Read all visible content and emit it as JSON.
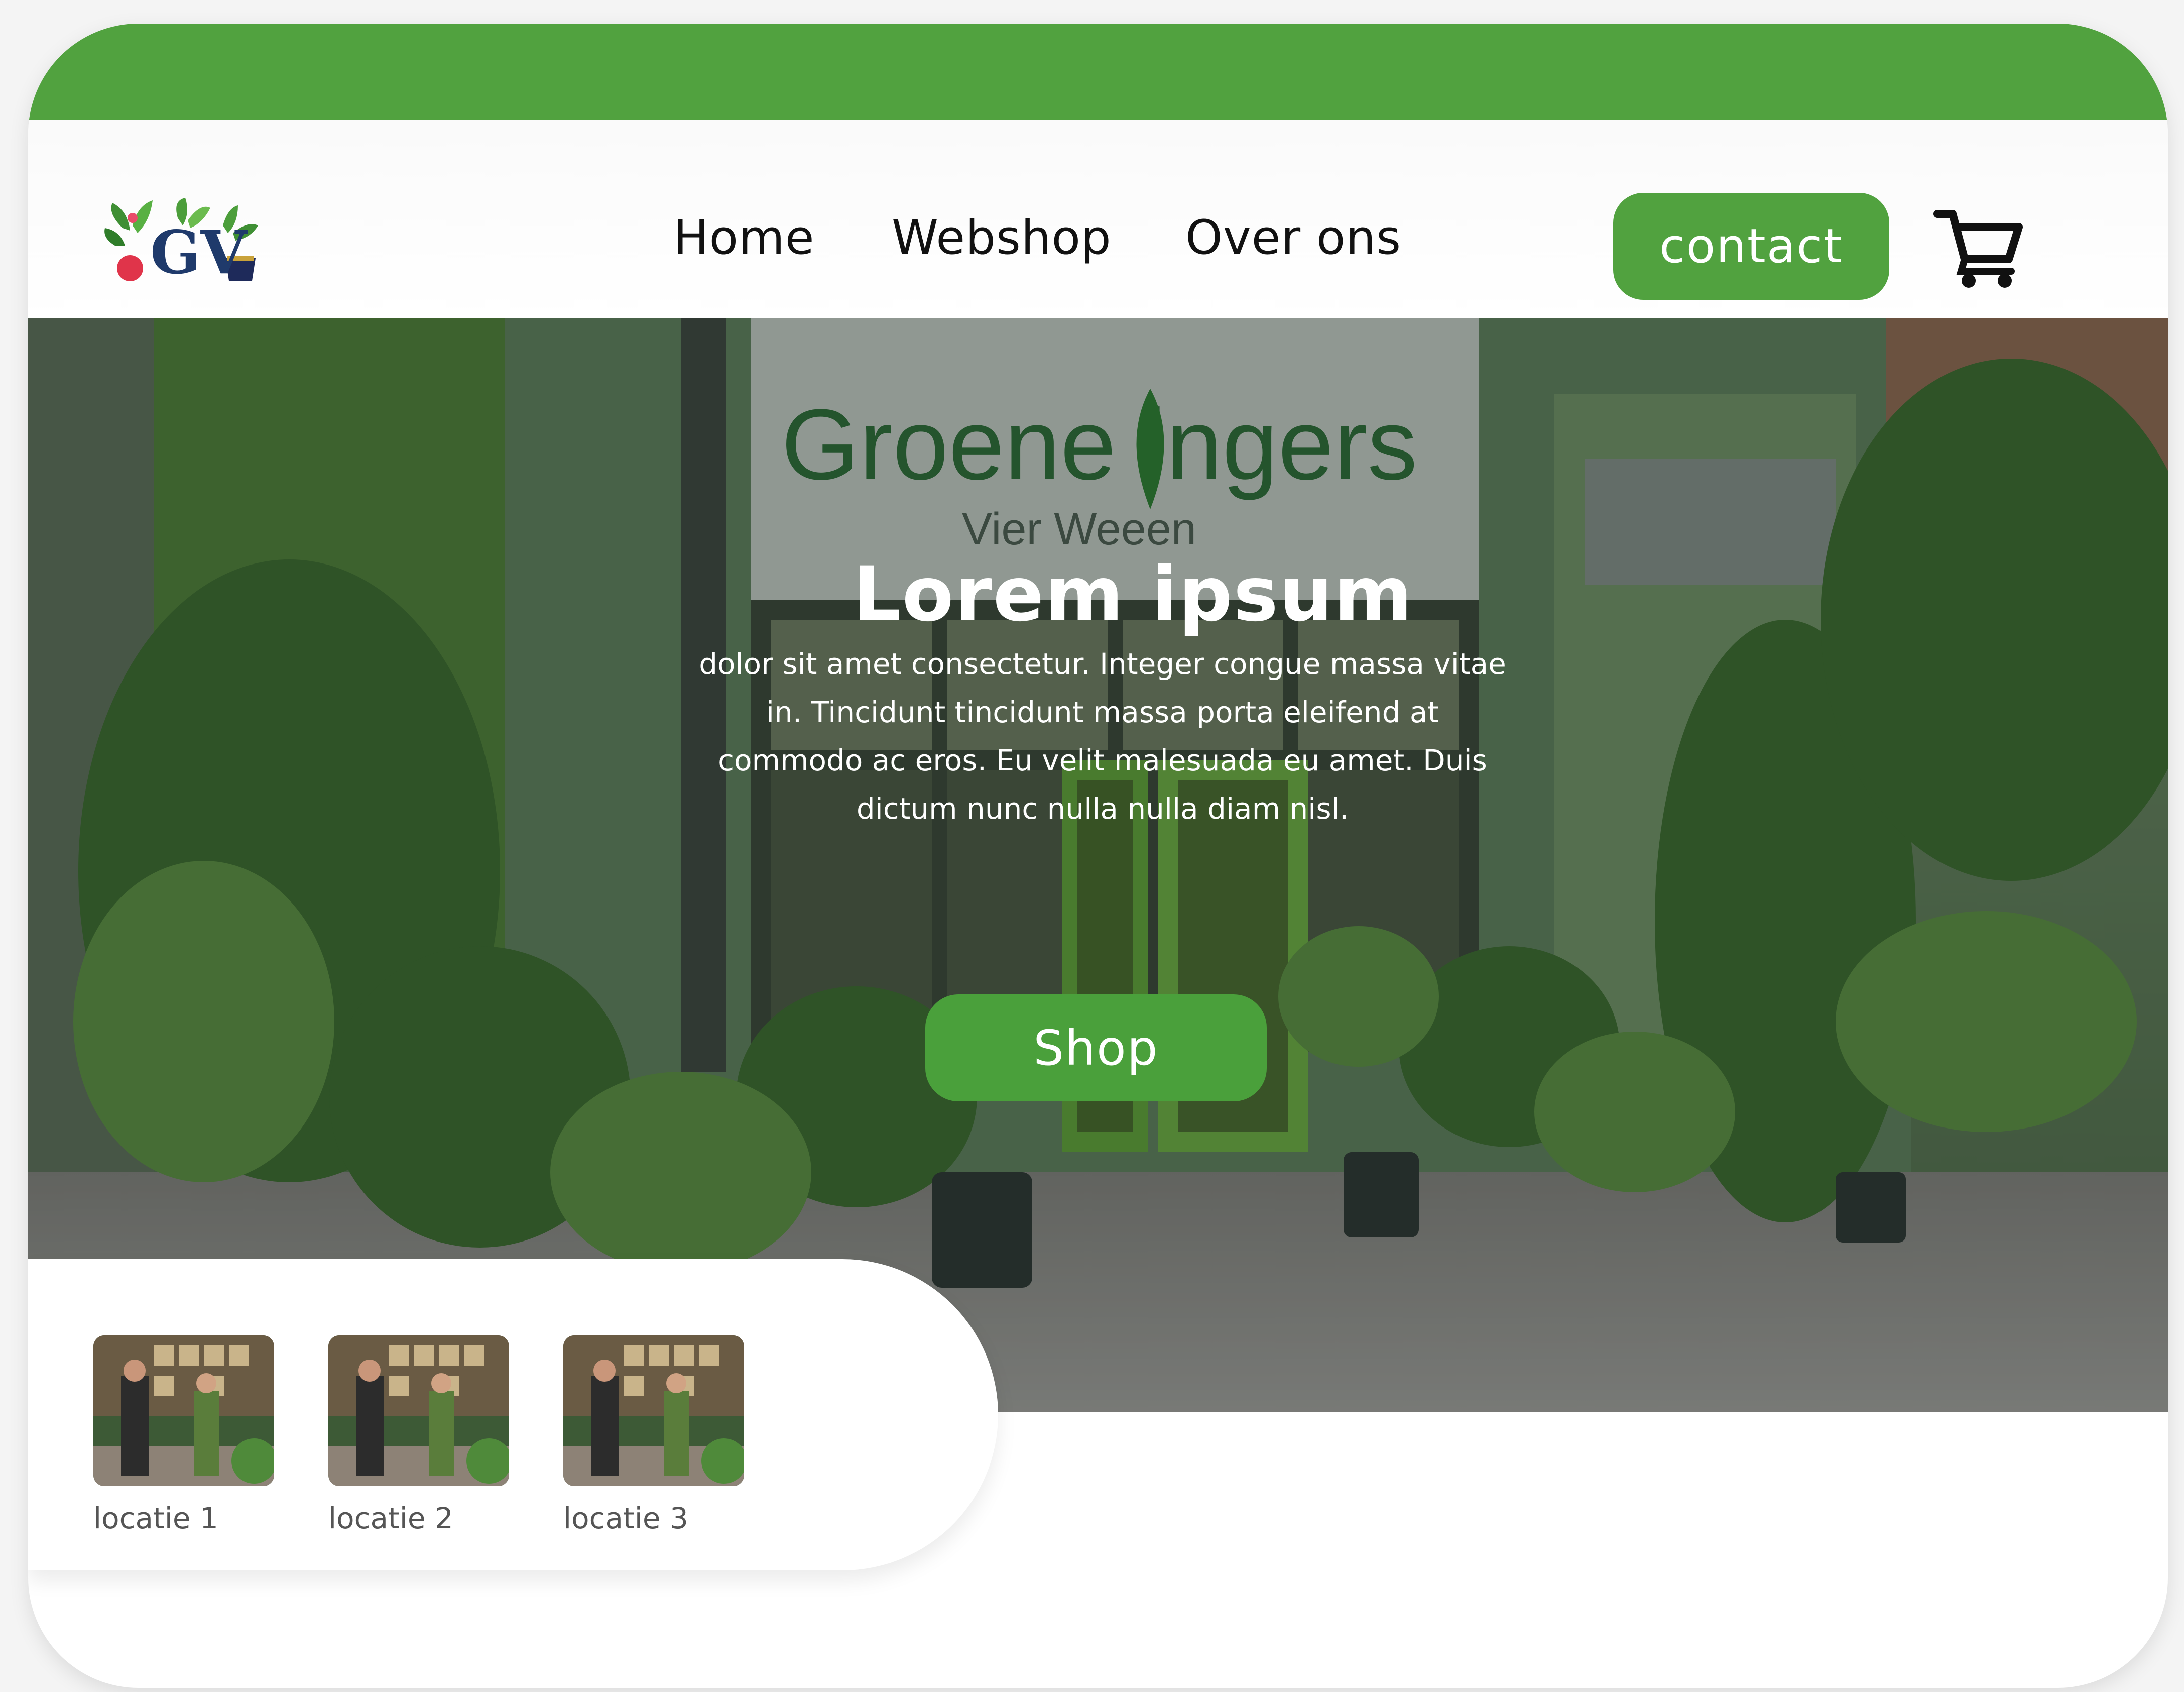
{
  "colors": {
    "brand_green": "#51a23f",
    "text_dark": "#111111",
    "white": "#ffffff",
    "muted": "#555555"
  },
  "logo": {
    "text": "GV"
  },
  "nav": {
    "items": [
      {
        "label": "Home"
      },
      {
        "label": "Webshop"
      },
      {
        "label": "Over ons"
      }
    ],
    "contact_label": "contact",
    "cart_icon": "shopping-cart-icon"
  },
  "hero": {
    "sign_text": "Groene ingers",
    "sign_subtext": "Vier Weeen",
    "title": "Lorem ipsum",
    "text": "dolor sit amet consectetur. Integer congue massa vitae in. Tincidunt tincidunt massa porta eleifend at commodo ac eros. Eu velit malesuada eu amet. Duis dictum nunc nulla nulla diam nisl.",
    "cta_label": "Shop"
  },
  "locations": [
    {
      "label": "locatie 1"
    },
    {
      "label": "locatie 2"
    },
    {
      "label": "locatie 3"
    }
  ]
}
